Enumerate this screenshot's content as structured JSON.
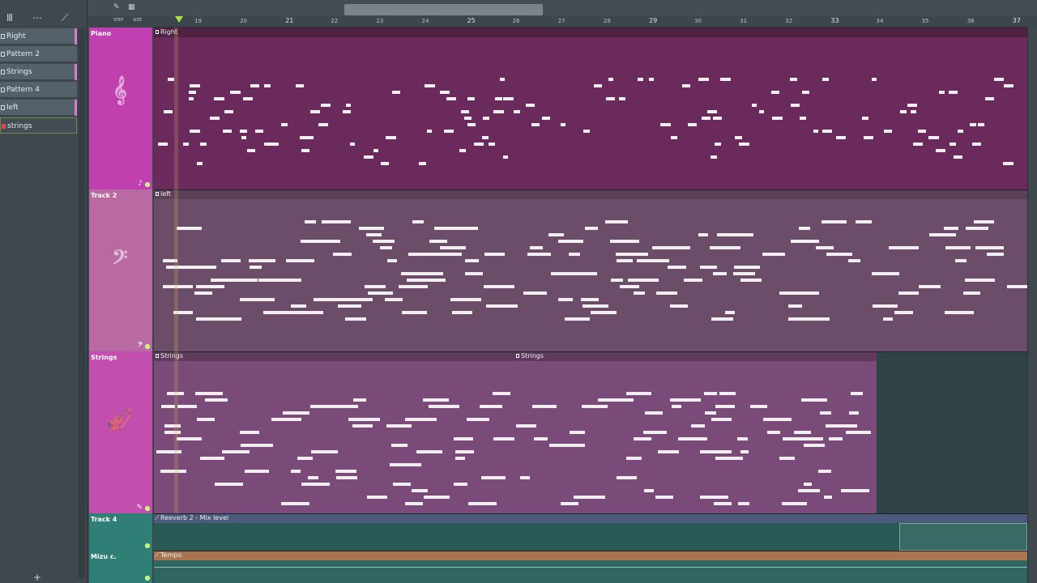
{
  "picker": {
    "items": [
      {
        "label": "Right",
        "tab_color": "#d87ad4"
      },
      {
        "label": "Pattern 2",
        "tab_color": ""
      },
      {
        "label": "Strings",
        "tab_color": "#d87ad4"
      },
      {
        "label": "Pattern 4",
        "tab_color": ""
      },
      {
        "label": "left",
        "tab_color": "#d87ad4"
      },
      {
        "label": "strings",
        "tab_color": ""
      }
    ],
    "add_label": "+"
  },
  "toolbar": {
    "icons": [
      "piano-roll-icon",
      "audio-clip-icon",
      "automation-clip-icon"
    ],
    "snap_labels": [
      "STEP",
      "SIZE"
    ]
  },
  "ruler": {
    "bars": [
      "19",
      "20",
      "21",
      "22",
      "23",
      "24",
      "25",
      "26",
      "27",
      "28",
      "29",
      "30",
      "31",
      "32",
      "33",
      "34",
      "35",
      "36",
      "37"
    ]
  },
  "tracks": [
    {
      "name": "Piano",
      "color": "#c040b0",
      "clef": "𝄞",
      "clip_labels": [
        "Right"
      ]
    },
    {
      "name": "Track 2",
      "color": "#b96aa3",
      "clef": "𝄢",
      "clip_labels": [
        "left"
      ]
    },
    {
      "name": "Strings",
      "color": "#c24fae",
      "clef": "🎻",
      "clip_labels": [
        "Strings",
        "Strings"
      ]
    },
    {
      "name": "Track 4",
      "color": "#2f7f76",
      "clip_labels": [
        "Reeverb 2 - Mix level"
      ]
    },
    {
      "name": "Mizu c.",
      "color": "#2f7f76",
      "clip_labels": [
        "Tempo"
      ]
    }
  ],
  "colors": {
    "accent_green": "#a8e040",
    "clip_pink": "#6a2a5c",
    "clip_mauve": "#6b4d6a",
    "clip_strings": "#7a4a78",
    "automation_teal": "#2f6661",
    "tempo_orange": "#a87550"
  }
}
